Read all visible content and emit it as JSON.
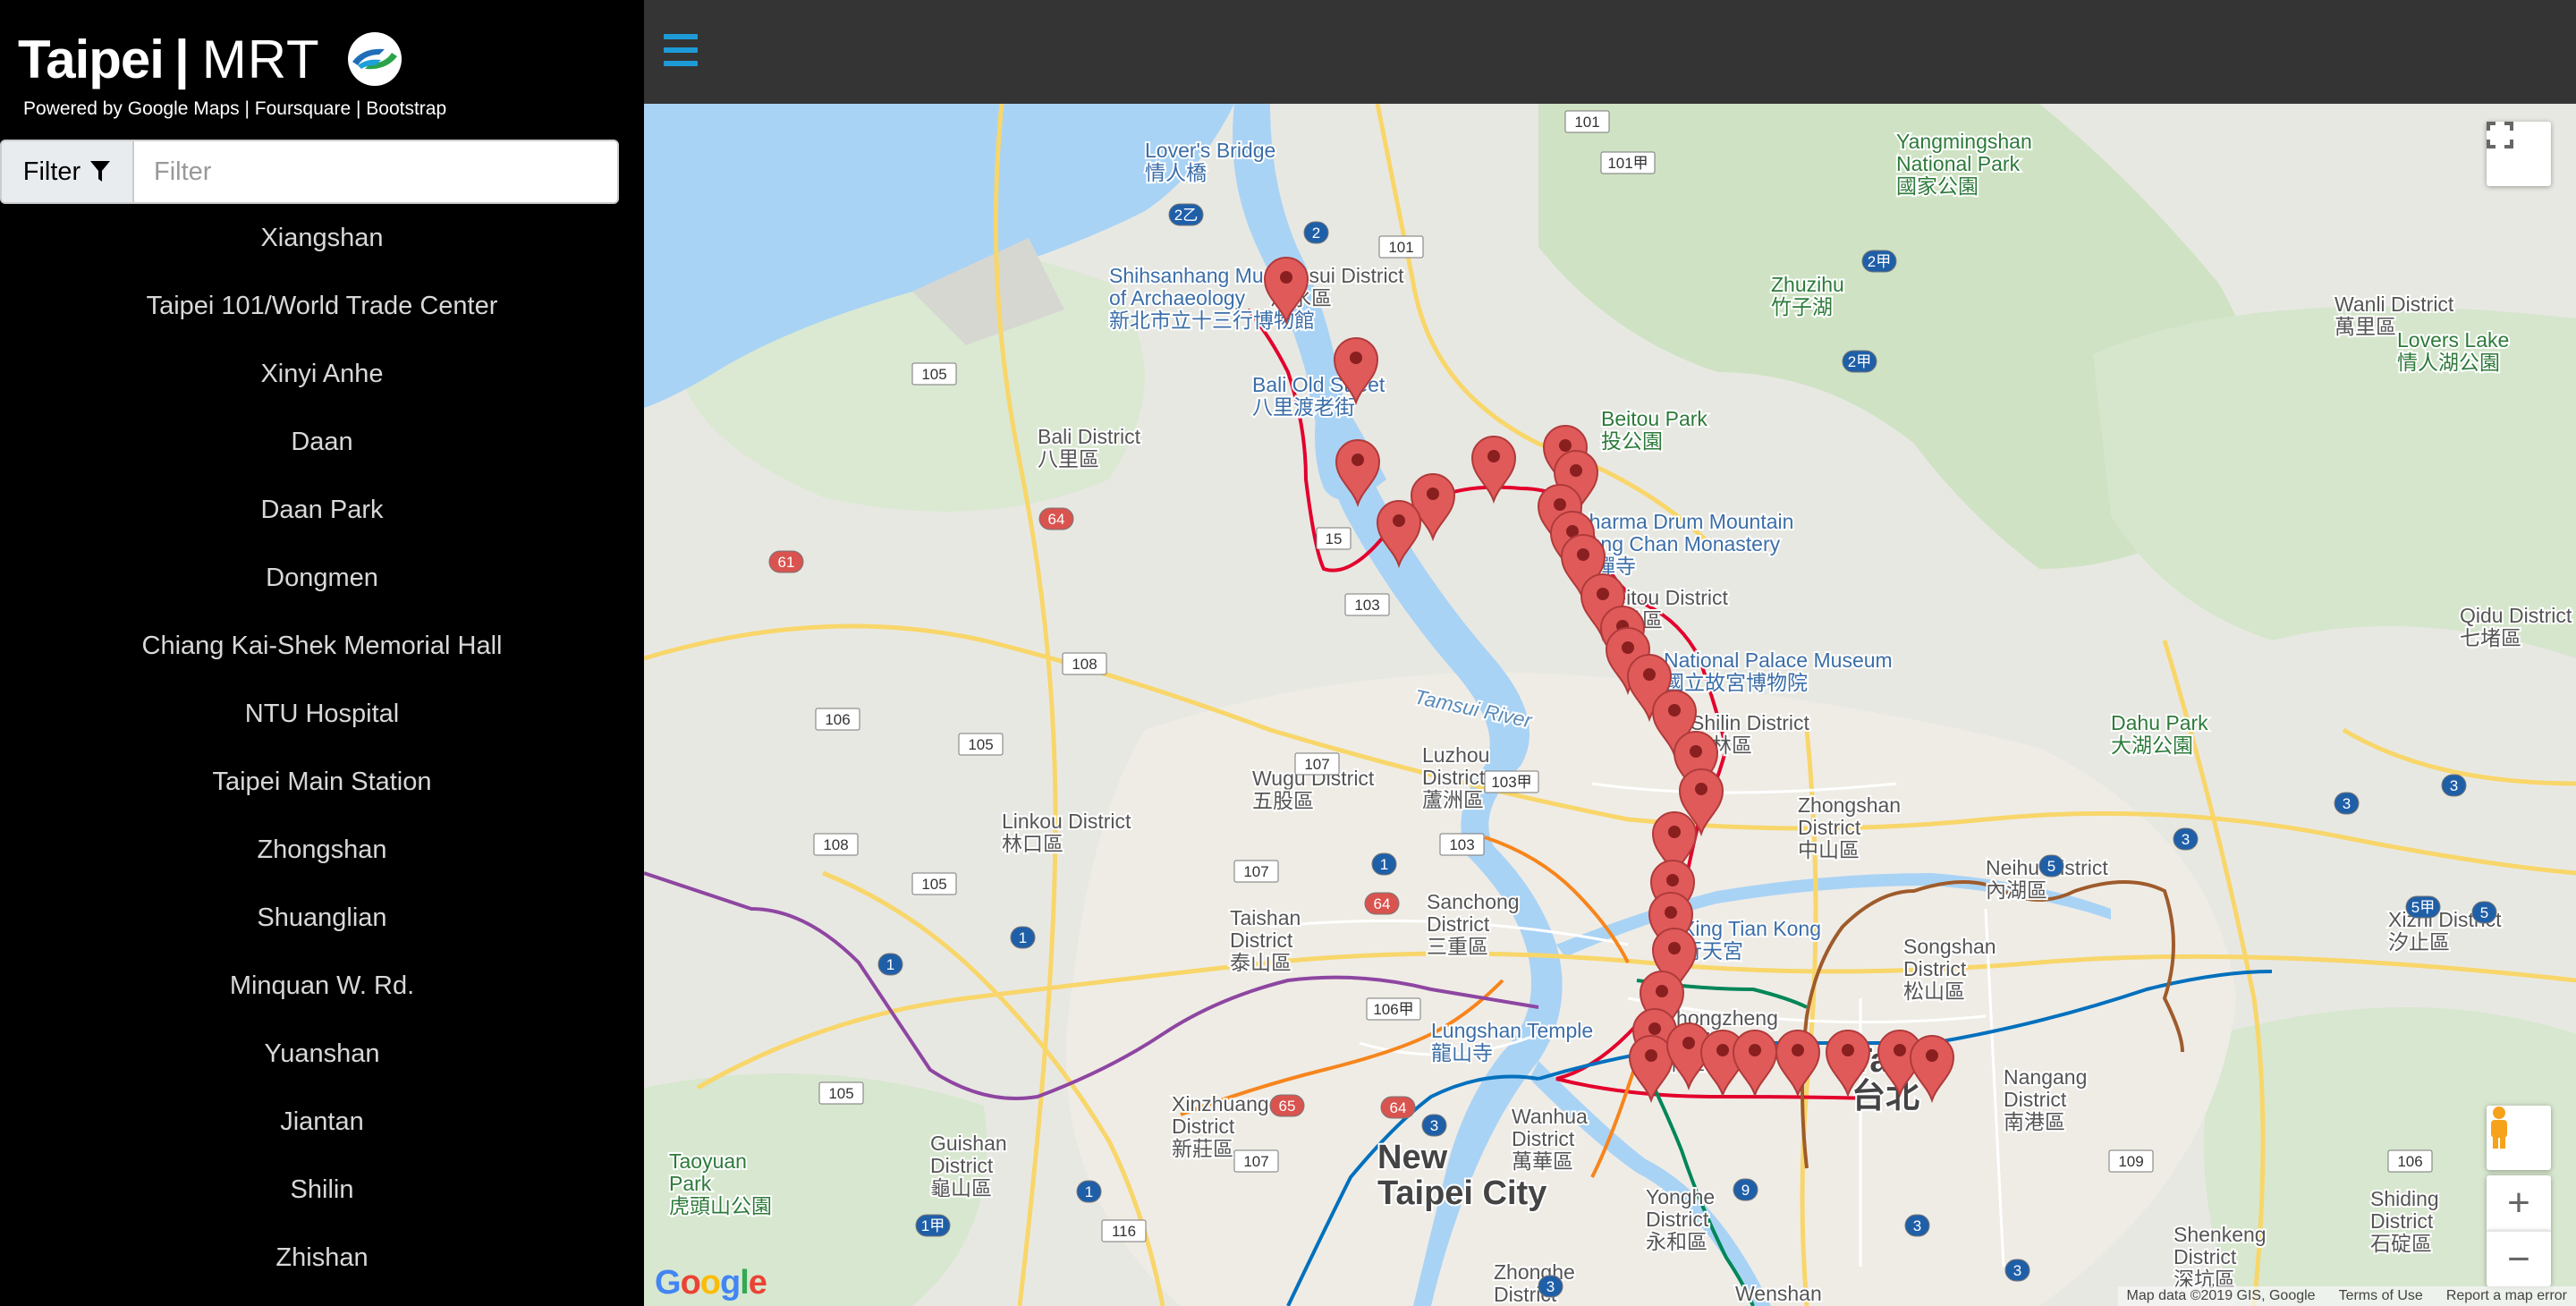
{
  "brand": {
    "title_bold": "Taipei",
    "separator": "|",
    "title_light": "MRT",
    "powered": "Powered by Google Maps | Foursquare | Bootstrap"
  },
  "filter": {
    "button_label": "Filter",
    "placeholder": "Filter",
    "value": ""
  },
  "stations": [
    "Xiangshan",
    "Taipei 101/World Trade Center",
    "Xinyi Anhe",
    "Daan",
    "Daan Park",
    "Dongmen",
    "Chiang Kai-Shek Memorial Hall",
    "NTU Hospital",
    "Taipei Main Station",
    "Zhongshan",
    "Shuanglian",
    "Minquan W. Rd.",
    "Yuanshan",
    "Jiantan",
    "Shilin",
    "Zhishan"
  ],
  "map": {
    "labels": [
      {
        "text": "Lover's Bridge",
        "sub": "情人橋",
        "kind": "poi"
      },
      {
        "text": "Yangmingshan",
        "sub": "National Park",
        "sub2": "國家公園",
        "kind": "park"
      },
      {
        "text": "Shihsanhang Museum",
        "sub": "of Archaeology",
        "sub2": "新北市立十三行博物館",
        "kind": "poi"
      },
      {
        "text": "Tamsui District",
        "sub": "淡水區",
        "kind": "district"
      },
      {
        "text": "Zhuzihu",
        "sub": "竹子湖",
        "kind": "park"
      },
      {
        "text": "Wanli District",
        "sub": "萬里區",
        "kind": "district"
      },
      {
        "text": "Lovers Lake",
        "sub": "情人湖公園",
        "kind": "park"
      },
      {
        "text": "Bali Old Street",
        "sub": "八里渡老街",
        "kind": "poi"
      },
      {
        "text": "Bali District",
        "sub": "八里區",
        "kind": "district"
      },
      {
        "text": "Beitou Park",
        "sub": "投公園",
        "kind": "park"
      },
      {
        "text": "Dharma Drum Mountain",
        "sub": "Nung Chan Monastery",
        "sub2": "農禪寺",
        "kind": "poi"
      },
      {
        "text": "Beitou District",
        "sub": "北投區",
        "kind": "district"
      },
      {
        "text": "National Palace Museum",
        "sub": "國立故宮博物院",
        "kind": "poi"
      },
      {
        "text": "Qidu District",
        "sub": "七堵區",
        "kind": "district"
      },
      {
        "text": "Shilin District",
        "sub": "士林區",
        "kind": "district"
      },
      {
        "text": "Dahu Park",
        "sub": "大湖公園",
        "kind": "park"
      },
      {
        "text": "Luzhou",
        "sub": "District",
        "sub2": "蘆洲區",
        "kind": "district"
      },
      {
        "text": "Wugu District",
        "sub": "五股區",
        "kind": "district"
      },
      {
        "text": "Linkou District",
        "sub": "林口區",
        "kind": "district"
      },
      {
        "text": "Zhongshan",
        "sub": "District",
        "sub2": "中山區",
        "kind": "district"
      },
      {
        "text": "Neihu District",
        "sub": "內湖區",
        "kind": "district"
      },
      {
        "text": "Sanchong",
        "sub": "District",
        "sub2": "三重區",
        "kind": "district"
      },
      {
        "text": "Xing Tian Kong",
        "sub": "行天宮",
        "kind": "poi"
      },
      {
        "text": "Songshan",
        "sub": "District",
        "sub2": "松山區",
        "kind": "district"
      },
      {
        "text": "Xizhi District",
        "sub": "汐止區",
        "kind": "district"
      },
      {
        "text": "Taishan",
        "sub": "District",
        "sub2": "泰山區",
        "kind": "district"
      },
      {
        "text": "Lungshan Temple",
        "sub": "龍山寺",
        "kind": "poi"
      },
      {
        "text": "Zhongzheng",
        "sub": "District",
        "sub2": "中正區",
        "kind": "district"
      },
      {
        "text": "Taipei",
        "sub": "台北",
        "kind": "city"
      },
      {
        "text": "Nangang",
        "sub": "District",
        "sub2": "南港區",
        "kind": "district"
      },
      {
        "text": "Xinzhuang",
        "sub": "District",
        "sub2": "新莊區",
        "kind": "district"
      },
      {
        "text": "New",
        "sub": "Taipei City",
        "kind": "city"
      },
      {
        "text": "Wanhua",
        "sub": "District",
        "sub2": "萬華區",
        "kind": "district"
      },
      {
        "text": "Guishan",
        "sub": "District",
        "sub2": "龜山區",
        "kind": "district"
      },
      {
        "text": "Taoyuan",
        "sub": "Park",
        "sub2": "虎頭山公園",
        "kind": "park"
      },
      {
        "text": "Yonghe",
        "sub": "District",
        "sub2": "永和區",
        "kind": "district"
      },
      {
        "text": "Shenkeng",
        "sub": "District",
        "sub2": "深坑區",
        "kind": "district"
      },
      {
        "text": "Shiding",
        "sub": "District",
        "sub2": "石碇區",
        "kind": "district"
      },
      {
        "text": "Zhonghe",
        "sub": "District",
        "kind": "district"
      },
      {
        "text": "Wenshan",
        "kind": "district"
      },
      {
        "text": "Tamsui River",
        "kind": "water"
      }
    ],
    "road_shields": [
      "101",
      "101甲",
      "2",
      "2乙",
      "101",
      "105",
      "2甲",
      "2甲",
      "15",
      "103",
      "64",
      "61",
      "108",
      "106",
      "105",
      "107",
      "103甲",
      "103",
      "108",
      "105",
      "107",
      "1",
      "64",
      "1",
      "1",
      "106甲",
      "65",
      "64",
      "105",
      "3",
      "1",
      "1甲",
      "107",
      "116",
      "9",
      "3",
      "3",
      "109",
      "106",
      "3",
      "5",
      "5",
      "5甲",
      "3",
      "3",
      "5",
      "3"
    ],
    "footer": {
      "data": "Map data ©2019 GIS, Google",
      "terms": "Terms of Use",
      "report": "Report a map error"
    },
    "google_logo": "Google"
  },
  "colors": {
    "accent_blue": "#1e9bd7",
    "marker_red": "#e05a5a",
    "water": "#a9d3f5",
    "mrt_red": "#e3002c",
    "mrt_blue": "#0070bd",
    "mrt_green": "#008659",
    "mrt_orange": "#f8b61c",
    "mrt_brown": "#c48c31",
    "mrt_purple": "#8e46a1"
  },
  "icons": {
    "filter": "funnel-icon",
    "menu": "hamburger-icon",
    "fullscreen": "fullscreen-icon",
    "pegman": "pegman-icon",
    "zoom_in": "plus-icon",
    "zoom_out": "minus-icon",
    "marker": "map-marker-icon"
  }
}
